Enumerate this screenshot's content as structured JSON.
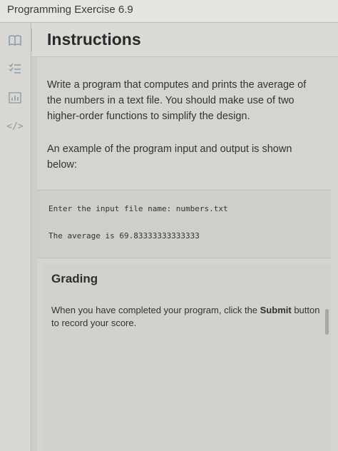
{
  "window": {
    "title": "Programming Exercise 6.9"
  },
  "sidebar": {
    "icons": [
      "book-icon",
      "checklist-icon",
      "chart-icon",
      "code-icon"
    ],
    "code_glyph": "</>"
  },
  "instructions": {
    "title": "Instructions",
    "paragraph1": "Write a program that computes and prints the average of the numbers in a text file. You should make use of two higher-order functions to simplify the design.",
    "paragraph2": "An example of the program input and output is shown below:",
    "code_input": "Enter the input file name: numbers.txt",
    "code_output": "The average is 69.83333333333333"
  },
  "grading": {
    "title": "Grading",
    "text_before": "When you have completed your program, click the ",
    "submit_word": "Submit",
    "text_after": " button to record your score."
  }
}
